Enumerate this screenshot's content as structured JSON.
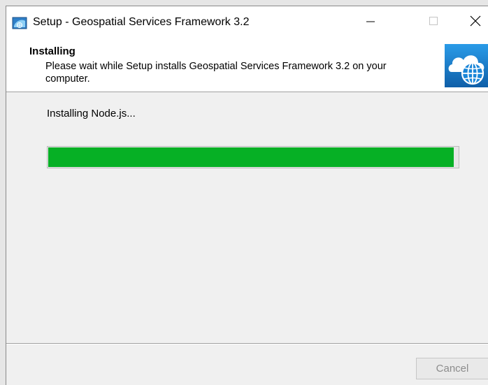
{
  "window": {
    "title": "Setup - Geospatial Services Framework 3.2"
  },
  "header": {
    "title": "Installing",
    "description": "Please wait while Setup installs Geospatial Services Framework 3.2 on your computer.",
    "image_icon": "cloud-globe-icon"
  },
  "body": {
    "status": "Installing Node.js...",
    "progress_fraction": 0.99
  },
  "footer": {
    "cancel_label": "Cancel",
    "cancel_enabled": false
  },
  "colors": {
    "progress": "#06b025",
    "header_bg": "#ffffff",
    "body_bg": "#f0f0f0",
    "icon_blue": "#1a86d8"
  }
}
